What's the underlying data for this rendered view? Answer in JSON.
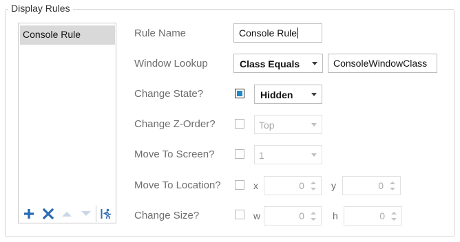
{
  "group": {
    "title": "Display Rules"
  },
  "rules_list": {
    "items": [
      {
        "label": "Console Rule"
      }
    ],
    "toolbar": [
      "add-icon",
      "remove-icon",
      "move-up-icon",
      "move-down-icon",
      "run-rule-icon"
    ]
  },
  "form": {
    "rule_name": {
      "label": "Rule Name",
      "value": "Console Rule"
    },
    "window_lookup": {
      "label": "Window Lookup",
      "mode": "Class Equals",
      "value": "ConsoleWindowClass"
    },
    "change_state": {
      "label": "Change State?",
      "checked": true,
      "value": "Hidden"
    },
    "change_z_order": {
      "label": "Change Z-Order?",
      "checked": false,
      "value": "Top"
    },
    "move_to_screen": {
      "label": "Move To Screen?",
      "checked": false,
      "value": "1"
    },
    "move_to_location": {
      "label": "Move To Location?",
      "checked": false,
      "x_label": "x",
      "x_value": "0",
      "y_label": "y",
      "y_value": "0"
    },
    "change_size": {
      "label": "Change Size?",
      "checked": false,
      "w_label": "w",
      "w_value": "0",
      "h_label": "h",
      "h_value": "0"
    }
  },
  "colors": {
    "accent": "#1e88c8",
    "add_icon": "#2b6cb3",
    "remove_icon": "#2b6cb3",
    "selection": "#d9d9d9"
  }
}
